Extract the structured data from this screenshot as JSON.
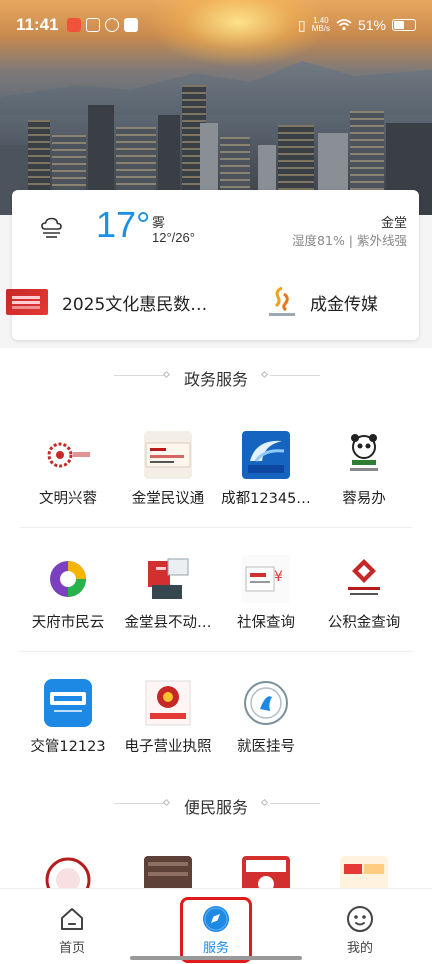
{
  "status_bar": {
    "time": "11:41",
    "net_speed_value": "1.40",
    "net_speed_unit": "MB/s",
    "battery": "51%"
  },
  "weather": {
    "icon": "cloud-fog-icon",
    "temperature": "17°",
    "condition": "雾",
    "range": "12°/26°",
    "location": "金堂",
    "humidity_uv": "湿度81% | 紫外线强"
  },
  "news": {
    "headline": "2025文化惠民数…",
    "media_name": "成金传媒"
  },
  "gov_section": {
    "title": "政务服务",
    "items": [
      {
        "label": "文明兴蓉",
        "icon": "civilization-icon"
      },
      {
        "label": "金堂民议通",
        "icon": "citizen-forum-icon"
      },
      {
        "label": "成都12345…",
        "icon": "hotline-12345-icon"
      },
      {
        "label": "蓉易办",
        "icon": "panda-service-icon"
      },
      {
        "label": "天府市民云",
        "icon": "citizen-cloud-icon"
      },
      {
        "label": "金堂县不动…",
        "icon": "property-registration-icon"
      },
      {
        "label": "社保查询",
        "icon": "social-security-icon"
      },
      {
        "label": "公积金查询",
        "icon": "housing-fund-icon"
      },
      {
        "label": "交管12123",
        "icon": "traffic-12123-icon"
      },
      {
        "label": "电子营业执照",
        "icon": "business-license-icon"
      },
      {
        "label": "就医挂号",
        "icon": "hospital-registration-icon"
      }
    ]
  },
  "people_section": {
    "title": "便民服务"
  },
  "bottom_nav": {
    "items": [
      {
        "label": "首页",
        "icon": "home-icon"
      },
      {
        "label": "服务",
        "icon": "compass-icon",
        "active": true
      },
      {
        "label": "我的",
        "icon": "profile-icon"
      }
    ]
  },
  "colors": {
    "accent": "#1e88e5",
    "temperature": "#1b8fe6",
    "highlight_box": "#e01b1b"
  }
}
